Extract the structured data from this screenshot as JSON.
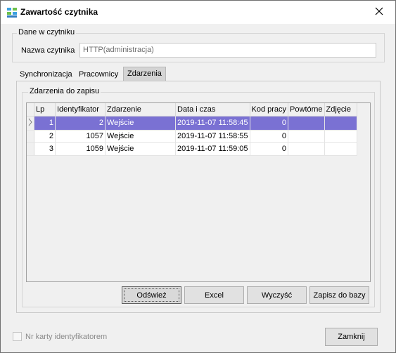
{
  "window": {
    "title": "Zawartość czytnika",
    "app_icon": "settings-grid-icon",
    "close_icon": "close-icon"
  },
  "reader_group": {
    "legend": "Dane w czytniku",
    "name_label": "Nazwa czytnika",
    "name_value": "HTTP(administracja)"
  },
  "tabs": [
    {
      "label": "Synchronizacja",
      "active": false
    },
    {
      "label": "Pracownicy",
      "active": false
    },
    {
      "label": "Zdarzenia",
      "active": true
    }
  ],
  "events_group": {
    "legend": "Zdarzenia do zapisu",
    "columns": [
      "Lp",
      "Identyfikator",
      "Zdarzenie",
      "Data i czas",
      "Kod pracy",
      "Powtórne",
      "Zdjęcie"
    ],
    "rows": [
      {
        "lp": "1",
        "id": "2",
        "event": "Wejście",
        "datetime": "2019-11-07 11:58:45",
        "work_code": "0",
        "repeat": "",
        "photo": "",
        "selected": true
      },
      {
        "lp": "2",
        "id": "1057",
        "event": "Wejście",
        "datetime": "2019-11-07 11:58:55",
        "work_code": "0",
        "repeat": "",
        "photo": "",
        "selected": false
      },
      {
        "lp": "3",
        "id": "1059",
        "event": "Wejście",
        "datetime": "2019-11-07 11:59:05",
        "work_code": "0",
        "repeat": "",
        "photo": "",
        "selected": false
      }
    ],
    "buttons": {
      "refresh": "Odśwież",
      "excel": "Excel",
      "clear": "Wyczyść",
      "save_db": "Zapisz do bazy"
    }
  },
  "footer": {
    "checkbox_label": "Nr karty identyfikatorem",
    "close_button": "Zamknij"
  },
  "colors": {
    "selection": "#7a71d3",
    "window_bg": "#f0f0f0"
  }
}
